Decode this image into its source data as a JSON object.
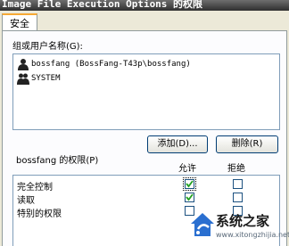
{
  "window": {
    "title": "Image File Execution Options 的权限"
  },
  "tabs": [
    {
      "label": "安全"
    }
  ],
  "users": {
    "label": "组或用户名称(G):",
    "items": [
      {
        "name": "bossfang (BossFang-T43p\\bossfang)",
        "icon": "user-icon"
      },
      {
        "name": "SYSTEM",
        "icon": "group-icon"
      }
    ]
  },
  "buttons": {
    "add": "添加(D)...",
    "remove": "删除(R)"
  },
  "permissions": {
    "label": "bossfang 的权限(P)",
    "allow_header": "允许",
    "deny_header": "拒绝",
    "rows": [
      {
        "name": "完全控制",
        "allow": true,
        "deny": false
      },
      {
        "name": "读取",
        "allow": true,
        "deny": false
      },
      {
        "name": "特别的权限",
        "allow": false,
        "deny": false
      }
    ]
  },
  "watermark": {
    "text": "系统之家",
    "url": "www.xitongzhijia.net"
  },
  "colors": {
    "titlebar": "#2f2f2f",
    "tab_accent": "#f7a934",
    "window_bg": "#ece9d8"
  }
}
